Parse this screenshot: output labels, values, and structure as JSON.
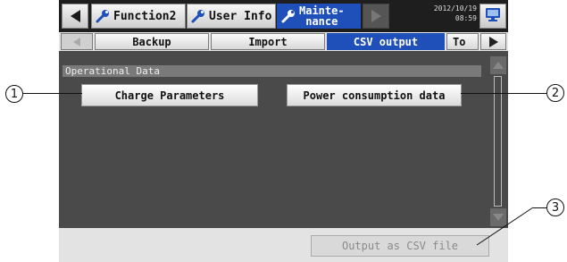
{
  "header": {
    "tabs": [
      {
        "label": "Function2",
        "icon": "wrench-icon"
      },
      {
        "label": "User Info",
        "icon": "wrench-icon"
      },
      {
        "label_line1": "Mainte-",
        "label_line2": "nance",
        "icon": "wrench-icon",
        "active": true
      }
    ],
    "date": "2012/10/19",
    "time": "08:59"
  },
  "subtabs": [
    {
      "label": "Backup"
    },
    {
      "label": "Import"
    },
    {
      "label": "CSV output",
      "active": true
    },
    {
      "label": "To"
    }
  ],
  "section": {
    "title": "Operational Data"
  },
  "buttons": {
    "charge": "Charge Parameters",
    "power": "Power consumption data",
    "output_csv": "Output as CSV file"
  },
  "callouts": [
    "1",
    "2",
    "3"
  ],
  "colors": {
    "active_tab": "#1f4fb8",
    "background": "#4a4a4a"
  }
}
